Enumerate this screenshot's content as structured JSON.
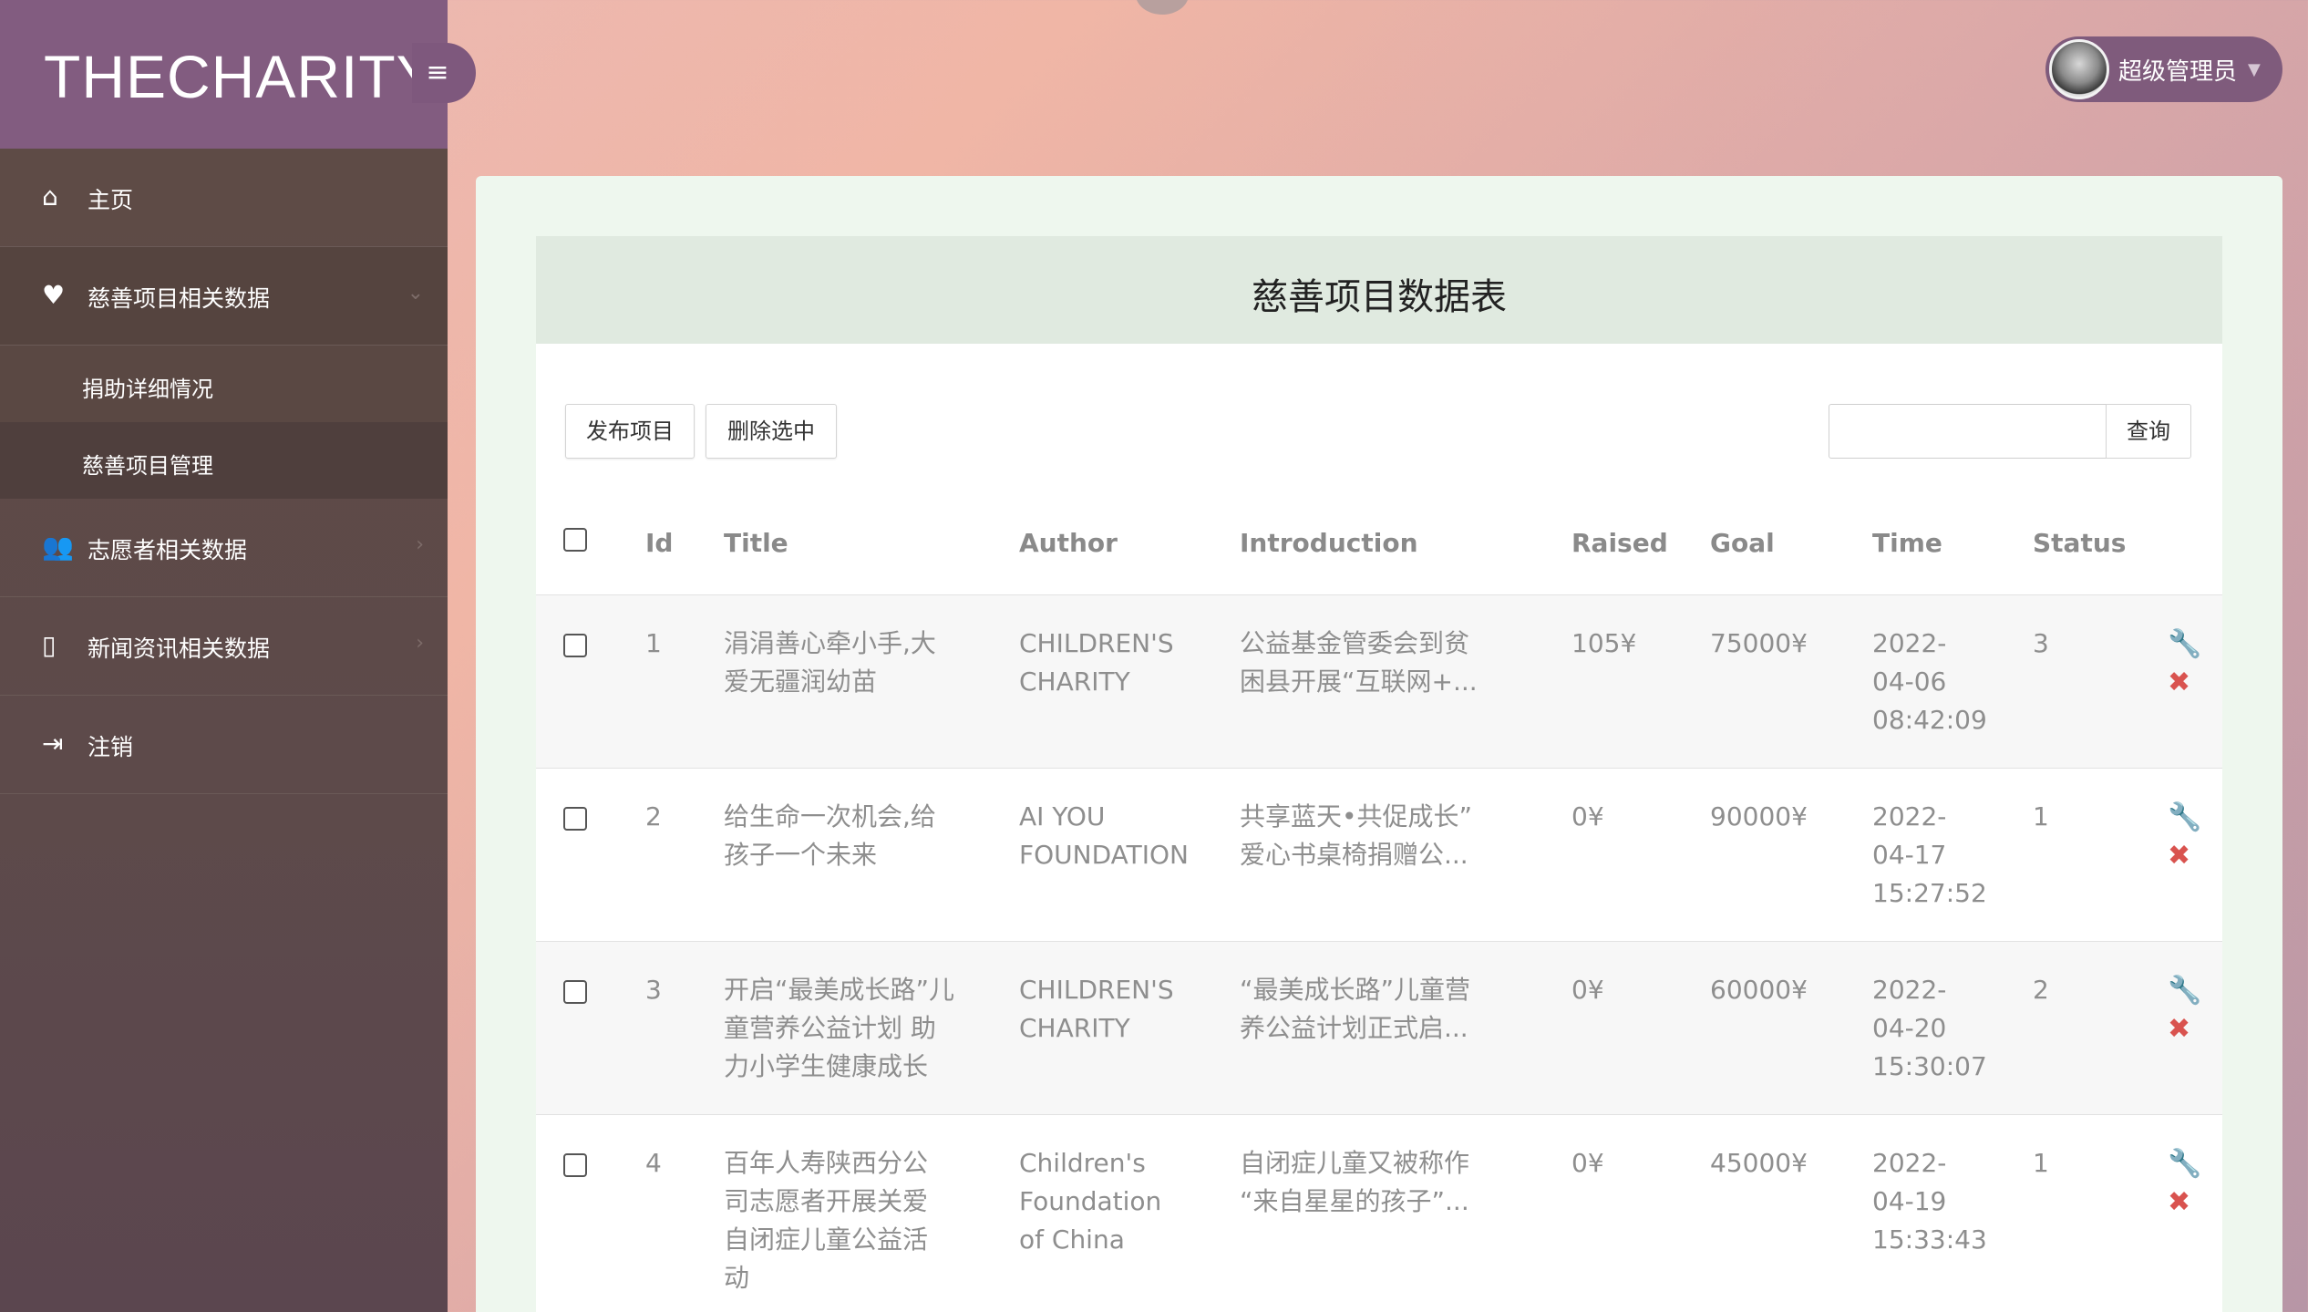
{
  "brand": {
    "title": "THECHARITY"
  },
  "header": {
    "user_name": "超级管理员"
  },
  "sidebar": {
    "items": [
      {
        "label": "主页"
      },
      {
        "label": "慈善项目相关数据"
      },
      {
        "label": "志愿者相关数据"
      },
      {
        "label": "新闻资讯相关数据"
      },
      {
        "label": "注销"
      }
    ],
    "subitems": [
      {
        "label": "捐助详细情况"
      },
      {
        "label": "慈善项目管理"
      }
    ]
  },
  "main": {
    "title": "慈善项目数据表",
    "publish_label": "发布项目",
    "delete_selected_label": "删除选中",
    "search_placeholder": "",
    "search_label": "查询",
    "columns": [
      "Id",
      "Title",
      "Author",
      "Introduction",
      "Raised",
      "Goal",
      "Time",
      "Status"
    ],
    "rows": [
      {
        "id": "1",
        "title": [
          "涓涓善心牵小手,大",
          "爱无疆润幼苗"
        ],
        "author": [
          "CHILDREN'S",
          "CHARITY"
        ],
        "intro": [
          "公益基金管委会到贫",
          "困县开展“互联网+..."
        ],
        "raised": "105¥",
        "goal": "75000¥",
        "time": [
          "2022-",
          "04-06",
          "08:42:09"
        ],
        "status": "3"
      },
      {
        "id": "2",
        "title": [
          "给生命一次机会,给",
          "孩子一个未来"
        ],
        "author": [
          "AI YOU",
          "FOUNDATION"
        ],
        "intro": [
          "共享蓝天•共促成长”",
          "爱心书桌椅捐赠公..."
        ],
        "raised": "0¥",
        "goal": "90000¥",
        "time": [
          "2022-",
          "04-17",
          "15:27:52"
        ],
        "status": "1"
      },
      {
        "id": "3",
        "title": [
          "开启“最美成长路”儿",
          "童营养公益计划 助",
          "力小学生健康成长"
        ],
        "author": [
          "CHILDREN'S",
          "CHARITY"
        ],
        "intro": [
          "“最美成长路”儿童营",
          "养公益计划正式启..."
        ],
        "raised": "0¥",
        "goal": "60000¥",
        "time": [
          "2022-",
          "04-20",
          "15:30:07"
        ],
        "status": "2"
      },
      {
        "id": "4",
        "title": [
          "百年人寿陕西分公",
          "司志愿者开展关爱",
          "自闭症儿童公益活",
          "动"
        ],
        "author": [
          "Children's",
          "Foundation",
          "of China"
        ],
        "intro": [
          "自闭症儿童又被称作",
          "“来自星星的孩子”..."
        ],
        "raised": "0¥",
        "goal": "45000¥",
        "time": [
          "2022-",
          "04-19",
          "15:33:43"
        ],
        "status": "1"
      }
    ]
  }
}
